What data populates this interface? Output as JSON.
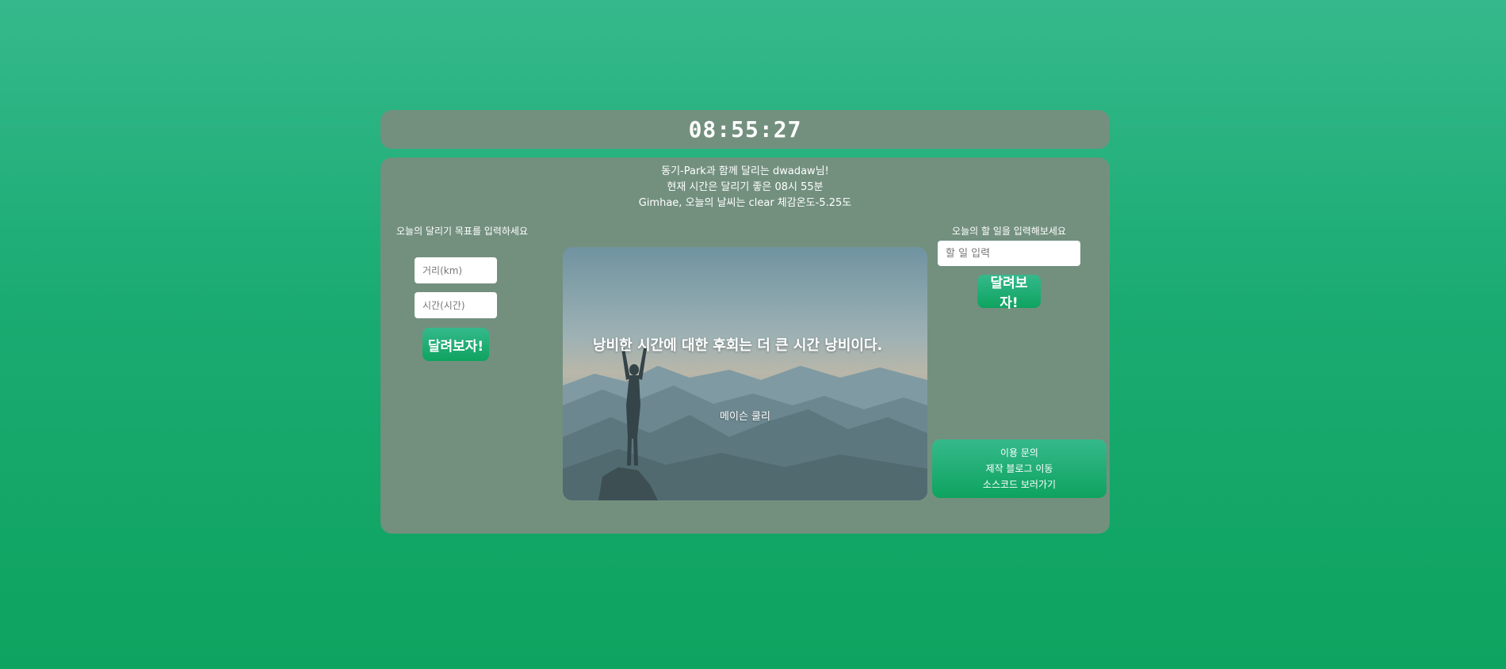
{
  "clock": {
    "time": "08:55:27"
  },
  "greeting": {
    "line1": "동기-Park과 함께 달리는 dwadaw님!",
    "line2": "현재 시간은 달리기 좋은 08시 55분",
    "line3": "Gimhae, 오늘의 날씨는 clear 체감온도-5.25도"
  },
  "running_goal": {
    "label": "오늘의 달리기 목표를 입력하세요",
    "distance_placeholder": "거리(km)",
    "time_placeholder": "시간(시간)",
    "submit_label": "달려보자!"
  },
  "todo": {
    "label": "오늘의 할 일을 입력해보세요",
    "input_placeholder": "할 일 입력",
    "submit_label": "달려보자!"
  },
  "quote": {
    "text": "낭비한 시간에 대한 후회는 더 큰 시간 낭비이다.",
    "author": "메이슨 쿨리"
  },
  "info_box": {
    "line1": "이용 문의",
    "line2": "제작 블로그 이동",
    "line3": "소스코드 보러가기"
  },
  "colors": {
    "background_top": "#35b98c",
    "background_bottom": "#0ea35f",
    "panel": "#73907f",
    "accent": "#1aab72"
  }
}
